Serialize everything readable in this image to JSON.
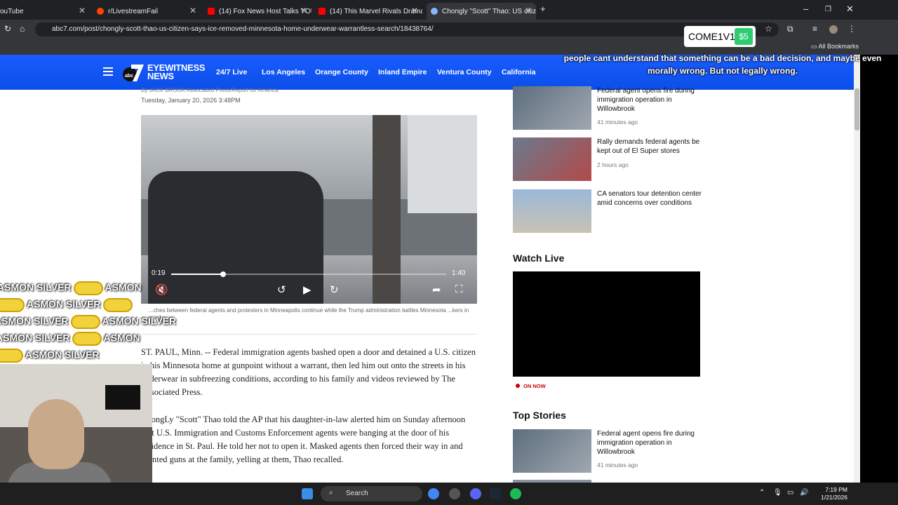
{
  "browser": {
    "tabs": [
      {
        "label": "ouTube",
        "active": false
      },
      {
        "label": "r/LivestreamFail",
        "active": false
      },
      {
        "label": "(14) Fox News Host Talks YOU",
        "active": false
      },
      {
        "label": "(14) This Marvel Rivals Drama is",
        "active": false
      },
      {
        "label": "Chongly \"Scott\" Thao: US citize",
        "active": true
      }
    ],
    "url": "abc7.com/post/chongly-scott-thao-us-citizen-says-ice-removed-minnesota-home-underwear-warrantless-search/18438764/",
    "bookmarks_label": "All Bookmarks"
  },
  "site": {
    "logo_line1": "EYEWITNESS",
    "logo_line2": "NEWS",
    "nav": [
      "24/7 Live",
      "Los Angeles",
      "Orange County",
      "Inland Empire",
      "Ventura County",
      "California"
    ]
  },
  "article": {
    "byline": "By JACK BROOK Associated Press/Report for America",
    "date": "Tuesday, January 20, 2026 3:48PM",
    "video": {
      "current": "0:19",
      "duration": "1:40",
      "progress": 0.19
    },
    "caption": "...ches between federal agents and protesters in Minneapolis continue while the Trump administration battles Minnesota ...kers in court.",
    "paragraphs": [
      "ST. PAUL, Minn. -- Federal immigration agents bashed open a door and detained a U.S. citizen in his Minnesota home at gunpoint without a warrant, then led him out onto the streets in his underwear in subfreezing conditions, according to his family and videos reviewed by The Associated Press.",
      "ChongLy \"Scott\" Thao told the AP that his daughter-in-law alerted him on Sunday afternoon that U.S. Immigration and Customs Enforcement agents were banging at the door of his residence in St. Paul. He told her not to open it. Masked agents then forced their way in and pointed guns at the family, yelling at them, Thao recalled."
    ]
  },
  "sidebar": {
    "related": [
      {
        "title": "Federal agent opens fire during immigration operation in Willowbrook",
        "time": "41 minutes ago"
      },
      {
        "title": "Rally demands federal agents be kept out of El Super stores",
        "time": "2 hours ago"
      },
      {
        "title": "CA senators tour detention center amid concerns over conditions",
        "time": ""
      }
    ],
    "watch_live": "Watch Live",
    "on_now": "ON NOW",
    "top_stories": "Top Stories",
    "top": [
      {
        "title": "Federal agent opens fire during immigration operation in Willowbrook",
        "time": "41 minutes ago"
      }
    ]
  },
  "overlay": {
    "donation_name": "COME1V1_",
    "donation_amount": "$5",
    "message": "people cant understand that something can be a bad decision, and maybe even morally wrong. But not legally wrong.",
    "chat_text": "ASMON SILVER",
    "chat_text_2": "ASMON"
  },
  "taskbar": {
    "search": "Search",
    "time": "7:19 PM",
    "date": "1/21/2026"
  },
  "colors": {
    "header_blue": "#0d56ff",
    "live_red": "#cc0000",
    "donation_green": "#2ecc71"
  }
}
